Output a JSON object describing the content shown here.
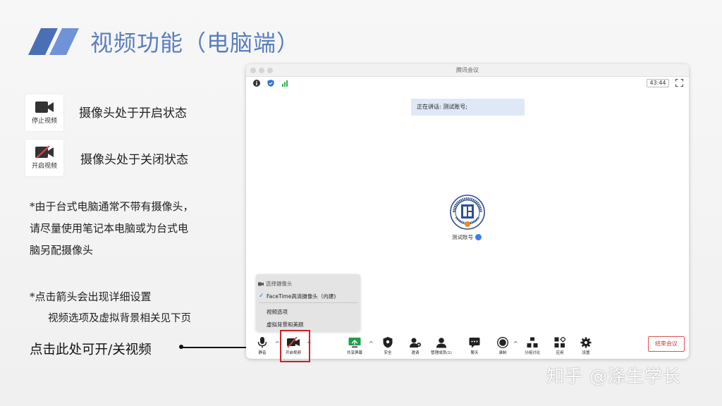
{
  "slide": {
    "title": "视频功能（电脑端）",
    "camera_on_tile_label": "停止视频",
    "camera_on_text": "摄像头处于开启状态",
    "camera_off_tile_label": "开启视频",
    "camera_off_text": "摄像头处于关闭状态",
    "note_lines": [
      "*由于台式电脑通常不带有摄像头，",
      "请尽量使用笔记本电脑或为台式电",
      "脑另配摄像头"
    ],
    "arrow_note": "*点击箭头会出现详细设置",
    "arrow_note_sub": "视频选项及虚拟背景相关见下页",
    "click_hint": "点击此处可开/关视频",
    "watermark": "知乎 @涤生学长",
    "accent_color": "#5a7fbf",
    "highlight_color": "#c4262b"
  },
  "window": {
    "app_title": "腾讯会议",
    "timer": "43:44",
    "speaking_label": "正在讲话: 测试账号;",
    "participant_name": "测试账号",
    "popup": {
      "header": "选择摄像头",
      "selected_camera": "FaceTime高清摄像头（内建)",
      "video_options": "视频选项",
      "virtual_bg": "虚拟背景和美颜"
    },
    "toolbar": {
      "mute": "静音",
      "start_video": "开启视频",
      "share": "共享屏幕",
      "security": "安全",
      "invite": "邀请",
      "manage": "管理成员(1)",
      "chat": "聊天",
      "record": "录制",
      "breakout": "分组讨论",
      "apps": "应用",
      "settings": "设置",
      "end": "结束会议"
    }
  }
}
